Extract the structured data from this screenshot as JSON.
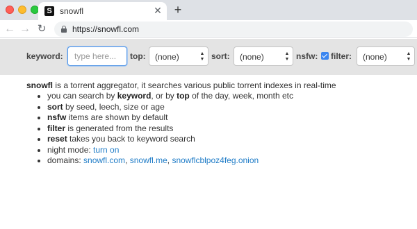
{
  "browser": {
    "tab_title": "snowfl",
    "favicon_letter": "S",
    "url": "https://snowfl.com"
  },
  "search": {
    "keyword_label": "keyword:",
    "keyword_placeholder": "type here...",
    "keyword_value": "",
    "top_label": "top:",
    "top_value": "(none)",
    "sort_label": "sort:",
    "sort_value": "(none)",
    "nsfw_label": "nsfw:",
    "nsfw_checked": true,
    "filter_label": "filter:",
    "filter_value": "(none)"
  },
  "content": {
    "intro_brand": "snowfl",
    "intro_text": " is a torrent aggregator, it searches various public torrent indexes in real-time",
    "items": [
      {
        "pre": "you can search by ",
        "b1": "keyword",
        "mid": ", or by ",
        "b2": "top",
        "post": " of the day, week, month etc"
      },
      {
        "b": "sort",
        "text": " by seed, leech, size or age"
      },
      {
        "b": "nsfw",
        "text": " items are shown by default"
      },
      {
        "b": "filter",
        "text": " is generated from the results"
      },
      {
        "b": "reset",
        "text": " takes you back to keyword search"
      },
      {
        "text": "night mode: ",
        "link": "turn on"
      },
      {
        "text": "domains: ",
        "links": [
          "snowfl.com",
          "snowfl.me",
          "snowflcblpoz4feg.onion"
        ],
        "sep": ", "
      }
    ]
  },
  "colors": {
    "link": "#1f7cc7",
    "search_bar_bg": "#e4e4e4",
    "checkbox": "#3b86f0"
  }
}
